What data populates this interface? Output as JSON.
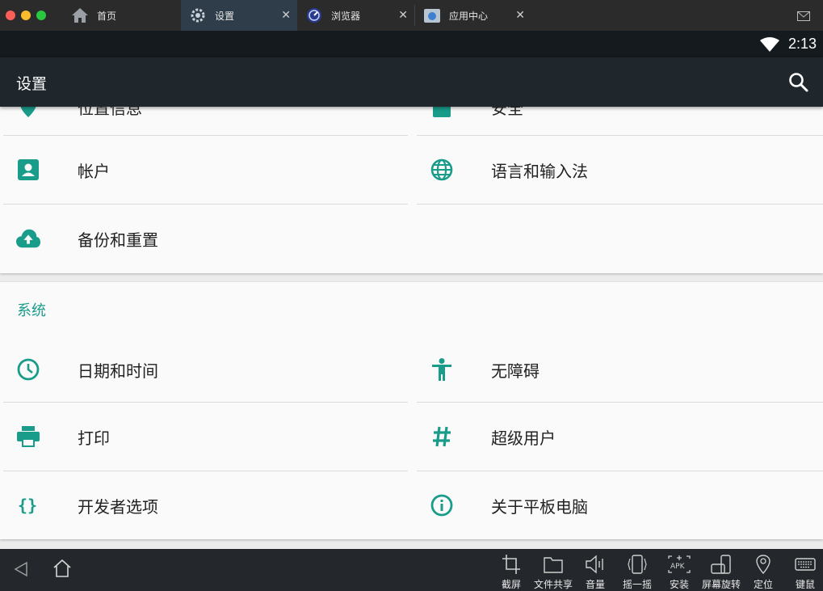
{
  "tabs": [
    {
      "label": "首页",
      "icon": "home-icon"
    },
    {
      "label": "设置",
      "icon": "gear-icon",
      "close": "✕"
    },
    {
      "label": "浏览器",
      "icon": "browser-icon",
      "close": "✕"
    },
    {
      "label": "应用中心",
      "icon": "app-center-icon",
      "close": "✕"
    }
  ],
  "status": {
    "time": "2:13"
  },
  "appbar": {
    "title": "设置"
  },
  "sections": {
    "personal_partial": {
      "left_label": "位置信息",
      "right_label": "安全"
    },
    "personal_items": [
      {
        "label": "帐户",
        "icon": "account-icon"
      },
      {
        "label": "语言和输入法",
        "icon": "globe-icon"
      },
      {
        "label": "备份和重置",
        "icon": "cloud-upload-icon"
      }
    ],
    "system": {
      "title": "系统",
      "items": [
        {
          "label": "日期和时间",
          "icon": "clock-icon"
        },
        {
          "label": "无障碍",
          "icon": "accessibility-icon"
        },
        {
          "label": "打印",
          "icon": "printer-icon"
        },
        {
          "label": "超级用户",
          "icon": "hash-icon"
        },
        {
          "label": "开发者选项",
          "icon": "braces-icon"
        },
        {
          "label": "关于平板电脑",
          "icon": "info-icon"
        }
      ]
    }
  },
  "toolbar": [
    {
      "label": "截屏",
      "icon": "crop-icon"
    },
    {
      "label": "文件共享",
      "icon": "folder-icon"
    },
    {
      "label": "音量",
      "icon": "volume-icon"
    },
    {
      "label": "摇一摇",
      "icon": "shake-icon"
    },
    {
      "label": "安装",
      "icon": "apk-icon"
    },
    {
      "label": "屏幕旋转",
      "icon": "rotate-icon"
    },
    {
      "label": "定位",
      "icon": "location-icon"
    },
    {
      "label": "键鼠",
      "icon": "keyboard-icon"
    }
  ],
  "colors": {
    "accent": "#1a9c8a",
    "appbar": "#1f262c",
    "statusbar": "#151a1e"
  }
}
